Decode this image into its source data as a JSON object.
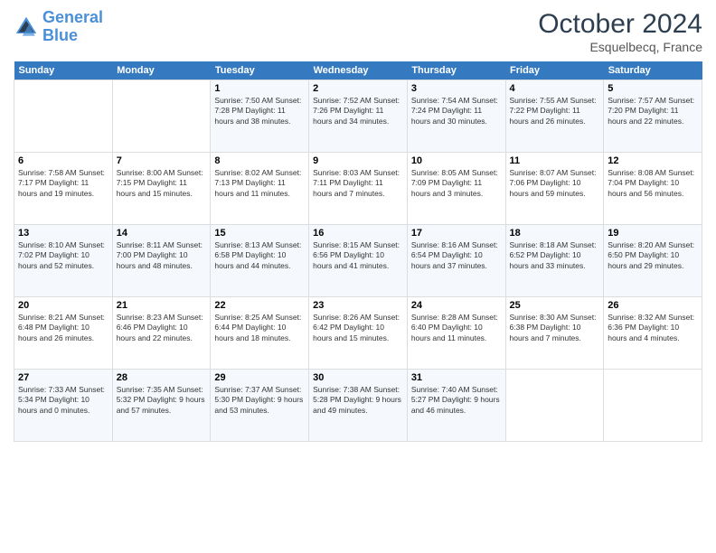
{
  "header": {
    "logo_line1": "General",
    "logo_line2": "Blue",
    "month": "October 2024",
    "location": "Esquelbecq, France"
  },
  "weekdays": [
    "Sunday",
    "Monday",
    "Tuesday",
    "Wednesday",
    "Thursday",
    "Friday",
    "Saturday"
  ],
  "weeks": [
    [
      {
        "day": "",
        "info": ""
      },
      {
        "day": "",
        "info": ""
      },
      {
        "day": "1",
        "info": "Sunrise: 7:50 AM\nSunset: 7:28 PM\nDaylight: 11 hours and 38 minutes."
      },
      {
        "day": "2",
        "info": "Sunrise: 7:52 AM\nSunset: 7:26 PM\nDaylight: 11 hours and 34 minutes."
      },
      {
        "day": "3",
        "info": "Sunrise: 7:54 AM\nSunset: 7:24 PM\nDaylight: 11 hours and 30 minutes."
      },
      {
        "day": "4",
        "info": "Sunrise: 7:55 AM\nSunset: 7:22 PM\nDaylight: 11 hours and 26 minutes."
      },
      {
        "day": "5",
        "info": "Sunrise: 7:57 AM\nSunset: 7:20 PM\nDaylight: 11 hours and 22 minutes."
      }
    ],
    [
      {
        "day": "6",
        "info": "Sunrise: 7:58 AM\nSunset: 7:17 PM\nDaylight: 11 hours and 19 minutes."
      },
      {
        "day": "7",
        "info": "Sunrise: 8:00 AM\nSunset: 7:15 PM\nDaylight: 11 hours and 15 minutes."
      },
      {
        "day": "8",
        "info": "Sunrise: 8:02 AM\nSunset: 7:13 PM\nDaylight: 11 hours and 11 minutes."
      },
      {
        "day": "9",
        "info": "Sunrise: 8:03 AM\nSunset: 7:11 PM\nDaylight: 11 hours and 7 minutes."
      },
      {
        "day": "10",
        "info": "Sunrise: 8:05 AM\nSunset: 7:09 PM\nDaylight: 11 hours and 3 minutes."
      },
      {
        "day": "11",
        "info": "Sunrise: 8:07 AM\nSunset: 7:06 PM\nDaylight: 10 hours and 59 minutes."
      },
      {
        "day": "12",
        "info": "Sunrise: 8:08 AM\nSunset: 7:04 PM\nDaylight: 10 hours and 56 minutes."
      }
    ],
    [
      {
        "day": "13",
        "info": "Sunrise: 8:10 AM\nSunset: 7:02 PM\nDaylight: 10 hours and 52 minutes."
      },
      {
        "day": "14",
        "info": "Sunrise: 8:11 AM\nSunset: 7:00 PM\nDaylight: 10 hours and 48 minutes."
      },
      {
        "day": "15",
        "info": "Sunrise: 8:13 AM\nSunset: 6:58 PM\nDaylight: 10 hours and 44 minutes."
      },
      {
        "day": "16",
        "info": "Sunrise: 8:15 AM\nSunset: 6:56 PM\nDaylight: 10 hours and 41 minutes."
      },
      {
        "day": "17",
        "info": "Sunrise: 8:16 AM\nSunset: 6:54 PM\nDaylight: 10 hours and 37 minutes."
      },
      {
        "day": "18",
        "info": "Sunrise: 8:18 AM\nSunset: 6:52 PM\nDaylight: 10 hours and 33 minutes."
      },
      {
        "day": "19",
        "info": "Sunrise: 8:20 AM\nSunset: 6:50 PM\nDaylight: 10 hours and 29 minutes."
      }
    ],
    [
      {
        "day": "20",
        "info": "Sunrise: 8:21 AM\nSunset: 6:48 PM\nDaylight: 10 hours and 26 minutes."
      },
      {
        "day": "21",
        "info": "Sunrise: 8:23 AM\nSunset: 6:46 PM\nDaylight: 10 hours and 22 minutes."
      },
      {
        "day": "22",
        "info": "Sunrise: 8:25 AM\nSunset: 6:44 PM\nDaylight: 10 hours and 18 minutes."
      },
      {
        "day": "23",
        "info": "Sunrise: 8:26 AM\nSunset: 6:42 PM\nDaylight: 10 hours and 15 minutes."
      },
      {
        "day": "24",
        "info": "Sunrise: 8:28 AM\nSunset: 6:40 PM\nDaylight: 10 hours and 11 minutes."
      },
      {
        "day": "25",
        "info": "Sunrise: 8:30 AM\nSunset: 6:38 PM\nDaylight: 10 hours and 7 minutes."
      },
      {
        "day": "26",
        "info": "Sunrise: 8:32 AM\nSunset: 6:36 PM\nDaylight: 10 hours and 4 minutes."
      }
    ],
    [
      {
        "day": "27",
        "info": "Sunrise: 7:33 AM\nSunset: 5:34 PM\nDaylight: 10 hours and 0 minutes."
      },
      {
        "day": "28",
        "info": "Sunrise: 7:35 AM\nSunset: 5:32 PM\nDaylight: 9 hours and 57 minutes."
      },
      {
        "day": "29",
        "info": "Sunrise: 7:37 AM\nSunset: 5:30 PM\nDaylight: 9 hours and 53 minutes."
      },
      {
        "day": "30",
        "info": "Sunrise: 7:38 AM\nSunset: 5:28 PM\nDaylight: 9 hours and 49 minutes."
      },
      {
        "day": "31",
        "info": "Sunrise: 7:40 AM\nSunset: 5:27 PM\nDaylight: 9 hours and 46 minutes."
      },
      {
        "day": "",
        "info": ""
      },
      {
        "day": "",
        "info": ""
      }
    ]
  ]
}
